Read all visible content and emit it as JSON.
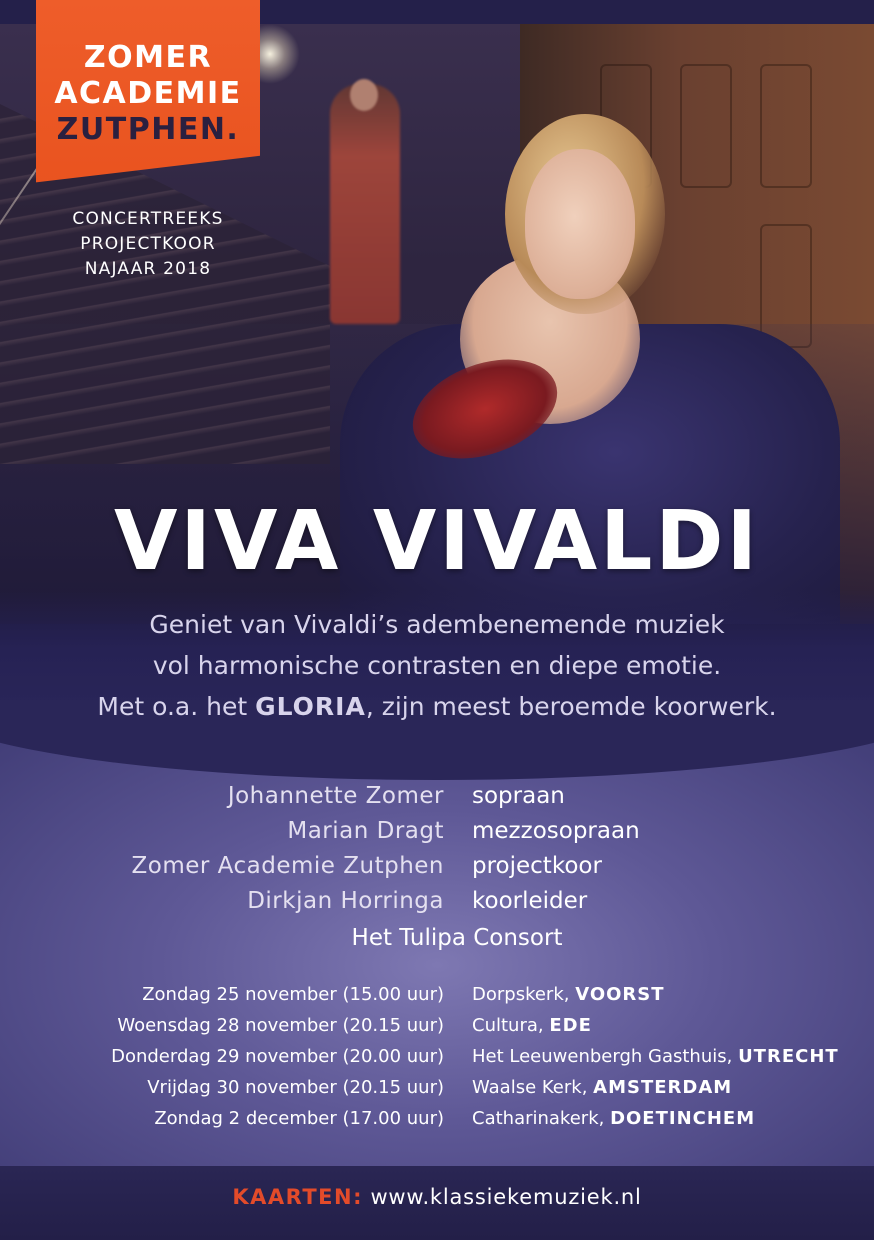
{
  "logo": {
    "line1": "ZOMER",
    "line2": "ACADEMIE",
    "line3": "ZUTPHEN."
  },
  "series": {
    "line1": "CONCERTREEKS",
    "line2": "PROJECTKOOR",
    "line3": "NAJAAR 2018"
  },
  "headline": "VIVA VIVALDI",
  "intro": {
    "line1": "Geniet van Vivaldi’s adembenemende muziek",
    "line2": "vol harmonische contrasten en diepe emotie.",
    "line3_pre": "Met o.a. het ",
    "line3_strong": "GLORIA",
    "line3_post": ", zijn meest beroemde koorwerk."
  },
  "performers": [
    {
      "name": "Johannette Zomer",
      "role": "sopraan"
    },
    {
      "name": "Marian Dragt",
      "role": "mezzosopraan"
    },
    {
      "name": "Zomer Academie Zutphen",
      "role": "projectkoor"
    },
    {
      "name": "Dirkjan Horringa",
      "role": "koorleider"
    }
  ],
  "ensemble": "Het Tulipa Consort",
  "concerts": [
    {
      "date": "Zondag 25 november (15.00 uur)",
      "venue": "Dorpskerk, ",
      "city": "VOORST"
    },
    {
      "date": "Woensdag 28 november (20.15 uur)",
      "venue": "Cultura, ",
      "city": "EDE"
    },
    {
      "date": "Donderdag 29 november (20.00 uur)",
      "venue": "Het Leeuwenbergh Gasthuis, ",
      "city": "UTRECHT"
    },
    {
      "date": "Vrijdag 30 november (20.15 uur)",
      "venue": "Waalse Kerk, ",
      "city": "AMSTERDAM"
    },
    {
      "date": "Zondag 2 december (17.00 uur)",
      "venue": "Catharinakerk, ",
      "city": "DOETINCHEM"
    }
  ],
  "tickets": {
    "label": "KAARTEN:",
    "url": " www.klassiekemuziek.nl"
  },
  "colors": {
    "logo_orange": "#e9531f",
    "tickets_label": "#e34b2a",
    "deep_purple": "#262254"
  }
}
